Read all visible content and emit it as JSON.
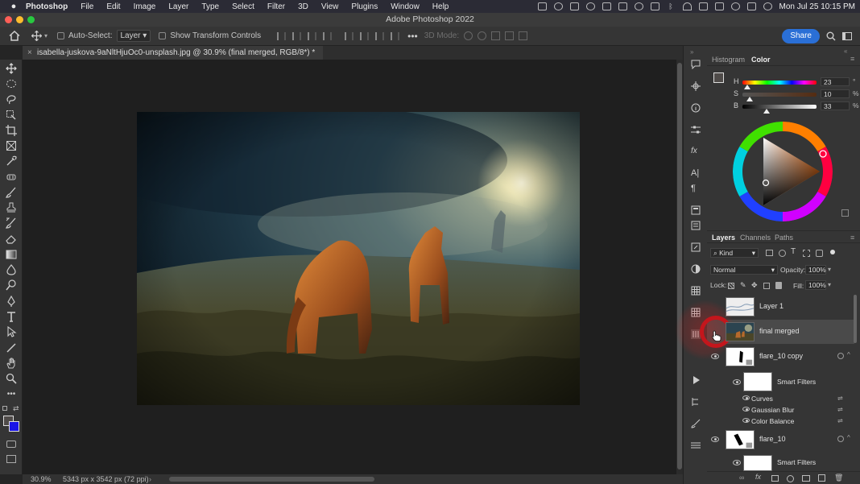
{
  "menubar": {
    "app": "Photoshop",
    "items": [
      "File",
      "Edit",
      "Image",
      "Layer",
      "Type",
      "Select",
      "Filter",
      "3D",
      "View",
      "Plugins",
      "Window",
      "Help"
    ],
    "clock": "Mon Jul 25  10:15 PM"
  },
  "window": {
    "title": "Adobe Photoshop 2022"
  },
  "options": {
    "auto_select_label": "Auto-Select:",
    "auto_select_value": "Layer",
    "transform_label": "Show Transform Controls",
    "mode_3d_label": "3D Mode:",
    "share_label": "Share"
  },
  "document": {
    "tab_title": "isabella-juskova-9aNltHjuOc0-unsplash.jpg @ 30.9% (final merged, RGB/8*) *",
    "zoom": "30.9%",
    "dimensions": "5343 px x 3542 px (72 ppi)"
  },
  "color_panel": {
    "tabs": [
      "Histogram",
      "Color"
    ],
    "active_tab": "Color",
    "sliders": [
      {
        "label": "H",
        "value": "23",
        "unit": "°",
        "position": 0.07
      },
      {
        "label": "S",
        "value": "10",
        "unit": "%",
        "position": 0.1
      },
      {
        "label": "B",
        "value": "33",
        "unit": "%",
        "position": 0.33
      }
    ],
    "foreground_color": "#4f4b49",
    "background_color": "#1a14e6"
  },
  "layers_panel": {
    "tabs": [
      "Layers",
      "Channels",
      "Paths"
    ],
    "active_tab": "Layers",
    "filter_label": "Kind",
    "blend_mode": "Normal",
    "opacity_label": "Opacity:",
    "opacity_value": "100%",
    "lock_label": "Lock:",
    "fill_label": "Fill:",
    "fill_value": "100%",
    "layers": [
      {
        "name": "Layer 1",
        "visible": false,
        "selected": false
      },
      {
        "name": "final merged",
        "visible": false,
        "selected": true
      },
      {
        "name": "flare_10 copy",
        "visible": true,
        "selected": false
      },
      {
        "name": "flare_10",
        "visible": true,
        "selected": false
      }
    ],
    "smart_filters_label": "Smart Filters",
    "filters": [
      "Curves",
      "Gaussian Blur",
      "Color Balance"
    ]
  }
}
